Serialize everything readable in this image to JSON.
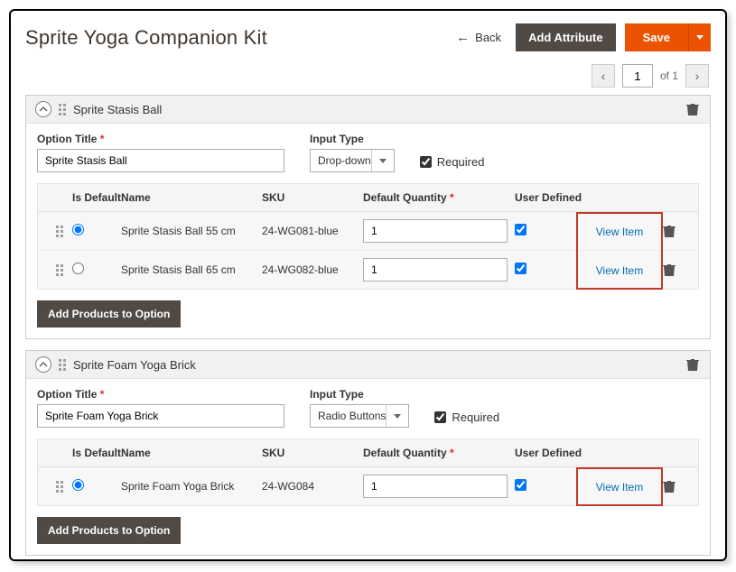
{
  "header": {
    "title": "Sprite Yoga Companion Kit",
    "back": "Back",
    "add_attribute": "Add Attribute",
    "save": "Save"
  },
  "pager": {
    "current": "1",
    "of": "of 1"
  },
  "labels": {
    "option_title": "Option Title",
    "input_type": "Input Type",
    "required": "Required",
    "is_default": "Is Default",
    "name": "Name",
    "sku": "SKU",
    "default_qty": "Default Quantity",
    "user_defined": "User Defined",
    "view_item": "View Item",
    "add_products": "Add Products to Option"
  },
  "options": [
    {
      "title": "Sprite Stasis Ball",
      "title_value": "Sprite Stasis Ball",
      "input_type": "Drop-down",
      "required": true,
      "products": [
        {
          "default": true,
          "name": "Sprite Stasis Ball 55 cm",
          "sku": "24-WG081-blue",
          "qty": "1",
          "user_defined": true
        },
        {
          "default": false,
          "name": "Sprite Stasis Ball 65 cm",
          "sku": "24-WG082-blue",
          "qty": "1",
          "user_defined": true
        }
      ]
    },
    {
      "title": "Sprite Foam Yoga Brick",
      "title_value": "Sprite Foam Yoga Brick",
      "input_type": "Radio Buttons",
      "required": true,
      "products": [
        {
          "default": true,
          "name": "Sprite Foam Yoga Brick",
          "sku": "24-WG084",
          "qty": "1",
          "user_defined": true
        }
      ]
    }
  ]
}
